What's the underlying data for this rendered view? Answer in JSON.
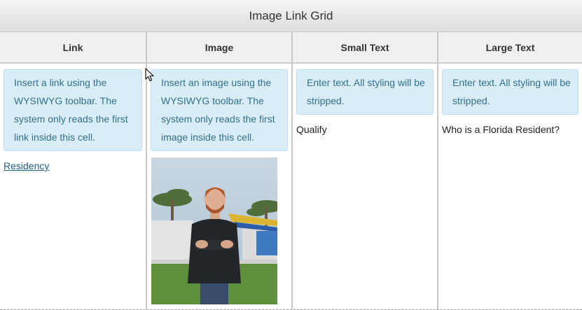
{
  "title": "Image Link Grid",
  "columns": [
    {
      "header": "Link",
      "hint": "Insert a link using the WYSIWYG toolbar. The system only reads the first link inside this cell.",
      "value": "Residency"
    },
    {
      "header": "Image",
      "hint": "Insert an image using the WYSIWYG toolbar. The system only reads the first image inside this cell."
    },
    {
      "header": "Small Text",
      "hint": "Enter text. All styling will be stripped.",
      "value": "Qualify"
    },
    {
      "header": "Large Text",
      "hint": "Enter text. All styling will be stripped.",
      "value": "Who is a Florida Resident?"
    }
  ],
  "icons": {
    "cursor": "mouse-pointer-icon"
  },
  "colors": {
    "hint_bg": "#d9edf7",
    "hint_text": "#31708f",
    "link": "#1f5f8b"
  }
}
